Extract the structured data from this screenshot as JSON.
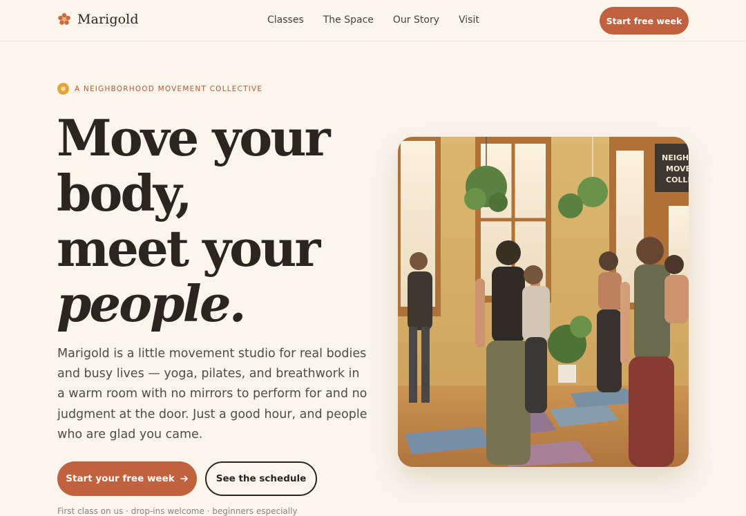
{
  "brand": {
    "name": "Marigold",
    "icon": "flower-icon"
  },
  "nav": {
    "links": [
      "Classes",
      "The Space",
      "Our Story",
      "Visit"
    ],
    "cta": "Start free week"
  },
  "hero": {
    "eyebrow": "A NEIGHBORHOOD MOVEMENT COLLECTIVE",
    "headline": [
      "Move your",
      "body,",
      "meet your",
      "people."
    ],
    "lede": "Marigold is a little movement studio for real bodies and busy lives — yoga, pilates, and breathwork in a warm room with no mirrors to perform for and no judgment at the door. Just a good hour, and people who are glad you came.",
    "primary_cta": "Start your free week",
    "primary_cta_icon": "arrow-right-icon",
    "secondary_cta": "See the schedule",
    "footnote": "First class on us · drop-ins welcome · beginners especially",
    "photo_sign": [
      "NEIGHB",
      "MOVE",
      "COLLE"
    ]
  },
  "colors": {
    "background": "#fbf5ec",
    "accent": "#c0613f",
    "ink": "#2b241f",
    "eyebrow": "#b05a3a",
    "marigold": "#e3a53a"
  }
}
